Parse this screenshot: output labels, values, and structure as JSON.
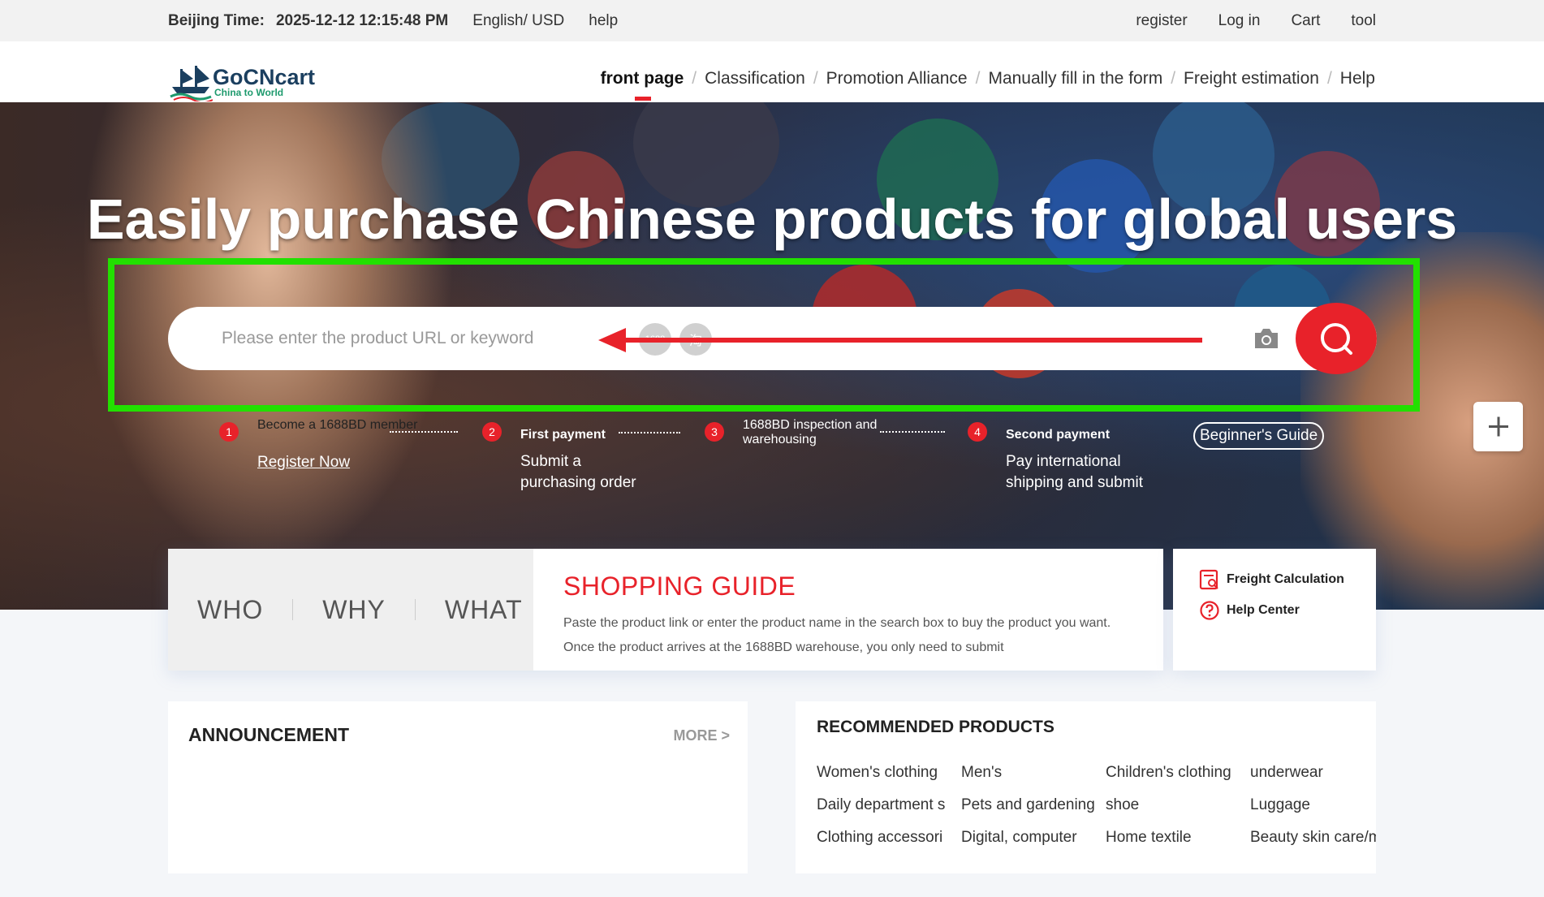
{
  "topbar": {
    "beijing_label": "Beijing Time:",
    "beijing_time": "2025-12-12 12:15:48 PM",
    "language": "English/ USD",
    "help": "help",
    "register": "register",
    "login": "Log in",
    "cart": "Cart",
    "tool": "tool"
  },
  "logo": {
    "name": "GoCNcart",
    "slogan": "China to World"
  },
  "nav": {
    "items": [
      "front page",
      "Classification",
      "Promotion Alliance",
      "Manually fill in the form",
      "Freight estimation",
      "Help"
    ],
    "separator": "/"
  },
  "hero": {
    "title": "Easily purchase Chinese products for global users",
    "search_placeholder": "Please enter the product URL or keyword",
    "badge1": "1688",
    "badge2": "淘"
  },
  "steps": [
    {
      "num": "1",
      "title": "Become a 1688BD member",
      "link": "Register Now"
    },
    {
      "num": "2",
      "title": "First payment",
      "desc": "Submit a purchasing order"
    },
    {
      "num": "3",
      "title": "1688BD inspection and warehousing"
    },
    {
      "num": "4",
      "title": "Second payment",
      "desc": "Pay international shipping and submit"
    }
  ],
  "beginners_guide": "Beginner's Guide",
  "www": {
    "who": "WHO",
    "why": "WHY",
    "what": "WHAT"
  },
  "shopping_guide": {
    "title": "SHOPPING GUIDE",
    "text": "Paste the product link or enter the product name in the search box to buy the product you want. Once the product arrives at the 1688BD warehouse, you only need to submit"
  },
  "side": {
    "freight": "Freight Calculation",
    "help_center": "Help Center"
  },
  "announcement": {
    "title": "ANNOUNCEMENT",
    "more": "MORE >"
  },
  "recommended": {
    "title": "RECOMMENDED PRODUCTS",
    "items": [
      "Women's clothing",
      "Men's",
      "Children's clothing",
      "underwear",
      "Daily department s",
      "Pets and gardening",
      "shoe",
      "Luggage",
      "Clothing accessori",
      "Digital, computer",
      "Home textile",
      "Beauty skin care/m"
    ]
  },
  "colors": {
    "accent": "#e8222a",
    "highlight_box": "#22e000",
    "topbar_bg": "#f2f2f2"
  }
}
